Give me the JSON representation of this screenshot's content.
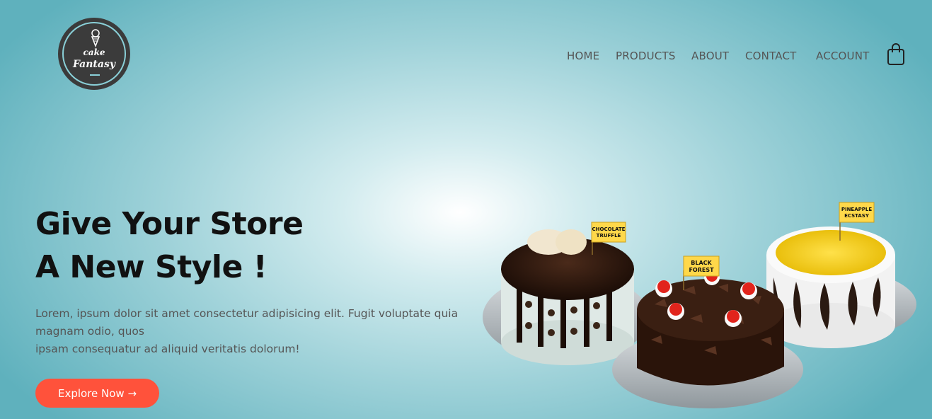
{
  "logo": {
    "line1": "cake",
    "line2": "Fantasy"
  },
  "nav": {
    "items": [
      "HOME",
      "PRODUCTS",
      "ABOUT",
      "CONTACT",
      "ACCOUNT"
    ],
    "cart_icon": "shopping-bag-icon"
  },
  "hero": {
    "title_line1": "Give Your Store",
    "title_line2": "A New Style !",
    "description_line1": "Lorem, ipsum dolor sit amet consectetur adipisicing elit. Fugit voluptate quia magnam odio, quos",
    "description_line2": "ipsam consequatur ad aliquid veritatis dolorum!",
    "cta_label": "Explore Now →",
    "cta_color": "#ff523b"
  },
  "cakes": {
    "chocolate_truffle": {
      "label_line1": "CHOCOLATE",
      "label_line2": "TRUFFLE"
    },
    "black_forest": {
      "label_line1": "BLACK",
      "label_line2": "FOREST"
    },
    "pineapple_ecstasy": {
      "label_line1": "PINEAPPLE",
      "label_line2": "ECSTASY"
    }
  },
  "colors": {
    "background_accent": "#5fb1bd",
    "text_dark": "#111111"
  }
}
